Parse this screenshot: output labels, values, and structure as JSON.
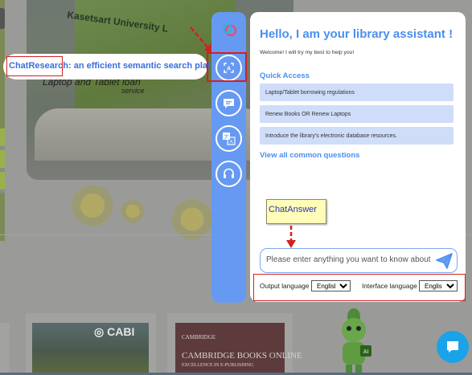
{
  "background": {
    "photo_sign_top": "Kasetsart University L",
    "photo_sign_loan": "Laptop and Tablet loan",
    "photo_sign_service": "service",
    "book_cabi": "CABI",
    "book_cambridge_top": "CAMBRIDGE",
    "book_cambridge_title": "CAMBRIDGE BOOKS ONLINE",
    "book_cambridge_sub": "EXCELLENCE IN E-PUBLISHING",
    "mascot_badge": "AI"
  },
  "callouts": {
    "chat_research_name": "ChatResearch",
    "chat_research_desc": ": an efficient semantic search platform",
    "chat_answer": "ChatAnswer"
  },
  "rail": {
    "buttons": [
      {
        "icon": "ai-search-icon"
      },
      {
        "icon": "chat-bubble-icon"
      },
      {
        "icon": "translate-icon"
      },
      {
        "icon": "headset-icon"
      }
    ]
  },
  "panel": {
    "title": "Hello, I am your library assistant !",
    "welcome": "Welcome! I will try my best to help you!",
    "quick_access_label": "Quick Access",
    "quick_items": [
      "Laptop/Tablet borrowing regulations",
      "Renew Books OR Renew Laptops",
      "Introduce the library's electronic database resources."
    ],
    "view_all": "View all common questions",
    "input_placeholder": "Please enter anything you want to know about.",
    "output_language_label": "Output language",
    "output_language_value": "English",
    "interface_language_label": "Interface language",
    "interface_language_value": "English"
  },
  "colors": {
    "accent": "#4a8ff0",
    "rail": "#6699f2",
    "highlight_red": "#d42020",
    "quick_item_bg": "#cfddf8",
    "fab": "#1aa3e8"
  }
}
